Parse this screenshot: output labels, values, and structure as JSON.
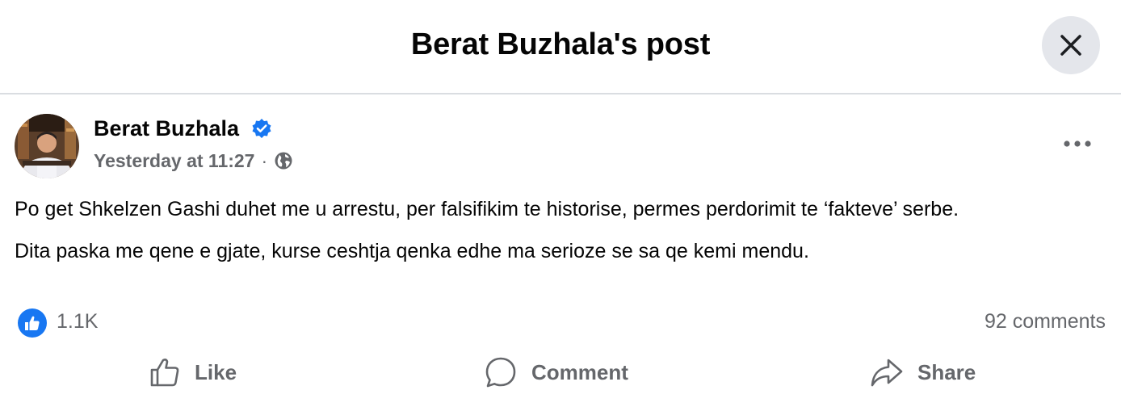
{
  "header": {
    "title": "Berat Buzhala's post"
  },
  "post": {
    "author": "Berat Buzhala",
    "timestamp": "Yesterday at 11:27",
    "separator": "·",
    "audience_icon": "globe-icon",
    "paragraphs": [
      "Po get Shkelzen Gashi duhet me u arrestu, per falsifikim te historise, permes perdorimit te ‘fakteve’ serbe.",
      "Dita paska me qene e gjate, kurse ceshtja qenka edhe ma serioze se sa qe kemi mendu."
    ],
    "reactions": "1.1K",
    "comments": "92 comments"
  },
  "actions": {
    "like": "Like",
    "comment": "Comment",
    "share": "Share"
  },
  "colors": {
    "accent": "#1877f2",
    "secondary_text": "#65676b",
    "divider": "#dadde1",
    "button_bg": "#e4e6eb"
  }
}
